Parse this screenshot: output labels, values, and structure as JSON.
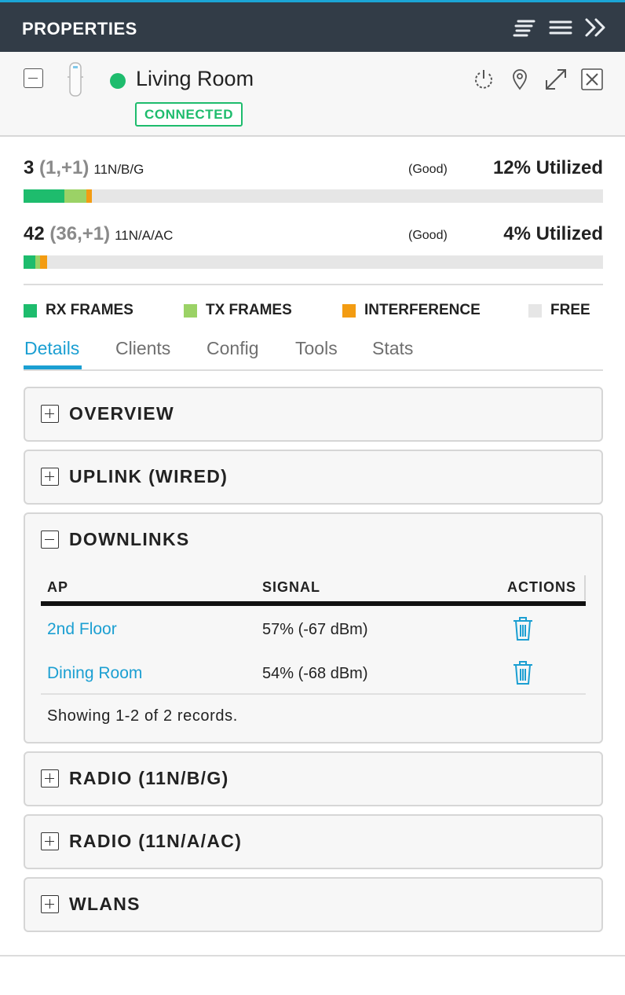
{
  "header": {
    "title": "PROPERTIES",
    "icons": [
      "sort-icon",
      "menu-icon",
      "collapse-panel-icon"
    ]
  },
  "device": {
    "name": "Living Room",
    "status": "CONNECTED",
    "status_color": "#1ebc6d",
    "actions": [
      "power-icon",
      "locate-icon",
      "expand-icon",
      "close-icon"
    ]
  },
  "radios": [
    {
      "count": "3",
      "detail": "(1,+1)",
      "band": "11N/B/G",
      "quality": "(Good)",
      "utilization": "12% Utilized",
      "usage": {
        "rx": 7,
        "tx": 3.8,
        "interference": 1
      }
    },
    {
      "count": "42",
      "detail": "(36,+1)",
      "band": "11N/A/AC",
      "quality": "(Good)",
      "utilization": "4% Utilized",
      "usage": {
        "rx": 2,
        "tx": 0.8,
        "interference": 1.2
      }
    }
  ],
  "legend": [
    {
      "label": "RX FRAMES",
      "color": "#1ebc6d"
    },
    {
      "label": "TX FRAMES",
      "color": "#9bd266"
    },
    {
      "label": "INTERFERENCE",
      "color": "#f39c12"
    },
    {
      "label": "FREE",
      "color": "#e6e6e6"
    }
  ],
  "tabs": [
    {
      "label": "Details",
      "active": true
    },
    {
      "label": "Clients",
      "active": false
    },
    {
      "label": "Config",
      "active": false
    },
    {
      "label": "Tools",
      "active": false
    },
    {
      "label": "Stats",
      "active": false
    }
  ],
  "sections": {
    "overview": "OVERVIEW",
    "uplink": "UPLINK (WIRED)",
    "downlinks": "DOWNLINKS",
    "radio_ng": "RADIO (11N/B/G)",
    "radio_nac": "RADIO (11N/A/AC)",
    "wlans": "WLANS"
  },
  "downlinks": {
    "columns": {
      "ap": "AP",
      "signal": "SIGNAL",
      "actions": "ACTIONS"
    },
    "rows": [
      {
        "ap": "2nd Floor",
        "signal": "57% (-67 dBm)"
      },
      {
        "ap": "Dining Room",
        "signal": "54% (-68 dBm)"
      }
    ],
    "footer": "Showing 1-2 of 2 records."
  },
  "colors": {
    "accent": "#1b9fd2",
    "header_bg": "#323c47",
    "link": "#1b9fd2"
  }
}
